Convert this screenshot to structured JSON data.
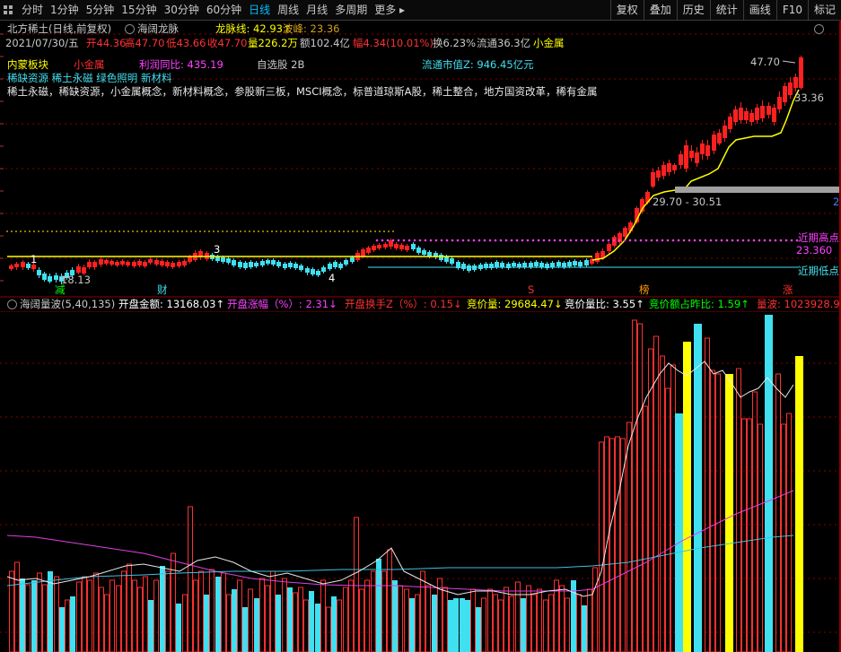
{
  "toolbar": {
    "periods": [
      "分时",
      "1分钟",
      "5分钟",
      "15分钟",
      "30分钟",
      "60分钟",
      "日线",
      "周线",
      "月线",
      "多周期",
      "更多 ▸"
    ],
    "active": "日线",
    "right_buttons": [
      "复权",
      "叠加",
      "历史",
      "统计",
      "画线",
      "F10",
      "标记"
    ]
  },
  "header": {
    "title": "北方稀土(日线,前复权)",
    "indicator_name": "海阔龙脉",
    "dragon_label": "龙脉线: 42.93↑",
    "wave_label": "波峰: 23.36"
  },
  "quote": {
    "date": "2021/07/30/五",
    "open": "开44.36",
    "high": "高47.70",
    "low": "低43.66",
    "close": "收47.70",
    "volume": "量226.2万",
    "amount": "额102.4亿",
    "change": "幅4.34(10.01%)",
    "turnover": "换6.23%",
    "float_cap": "流通36.3亿",
    "sector": "小金属"
  },
  "info": {
    "region": "内蒙板块",
    "industry": "小金属",
    "profit_yoy": "利润同比: 435.19",
    "watchlist": "自选股 2B",
    "float_mv": "流通市值Z: 946.45亿元",
    "tags": "稀缺资源  稀土永磁  绿色照明  新材料",
    "concepts": "稀土永磁，稀缺资源，小金属概念，新材料概念，参股新三板，MSCI概念，标普道琼斯A股，稀土整合，地方国资改革，稀有金属"
  },
  "annotations": {
    "price_high": "47.70",
    "price_mid": "33.36",
    "range_label": "29.70 - 30.51",
    "near_high_label": "近期高点",
    "near_high_value": "23.360",
    "near_low_label": "近期低点",
    "low_value": "18.13",
    "wave1": "1",
    "wave3": "3",
    "wave4": "4",
    "marker_jian": "减",
    "marker_cai": "财",
    "marker_s": "S",
    "marker_bang": "榜",
    "marker_zhang": "涨",
    "right_edge_2": "2"
  },
  "sub": {
    "title": "海阔量波(5,40,135)",
    "open_amount": "开盘金额: 13168.03↑",
    "open_change": "开盘涨幅（%）: 2.31↓",
    "open_turnover": "开盘换手Z（%）: 0.15↓",
    "bid_volume": "竞价量: 29684.47↓",
    "bid_ratio": "竞价量比: 3.55↑",
    "bid_amount_ratio": "竞价额占昨比: 1.59↑",
    "wave_volume": "量波: 1023928.9"
  },
  "colors": {
    "up": "#ff2020",
    "down": "#40e0f0",
    "yellow": "#ffff00",
    "magenta": "#ff40ff",
    "cyan_text": "#40e0f0",
    "gridline": "#8b0000"
  }
}
